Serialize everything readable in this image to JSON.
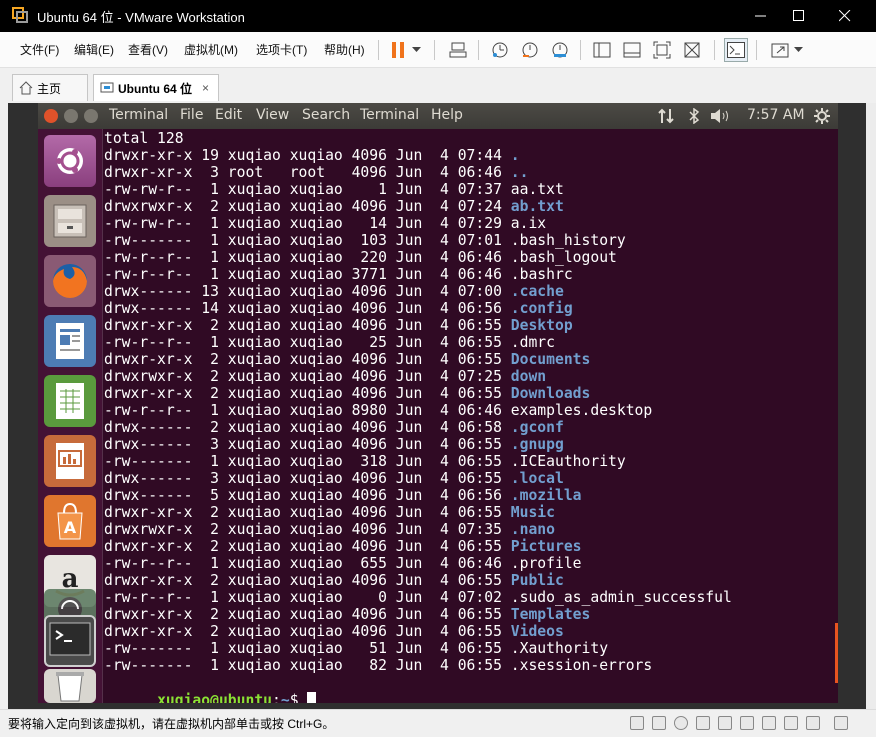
{
  "window": {
    "title": "Ubuntu 64 位 - VMware Workstation",
    "minimize_glyph": "—",
    "maximize_glyph": "☐",
    "close_glyph": "✕"
  },
  "menu": [
    "文件(F)",
    "编辑(E)",
    "查看(V)",
    "虚拟机(M)",
    "选项卡(T)",
    "帮助(H)"
  ],
  "toolbar": {
    "icons": [
      "pause-icon",
      "dropdown-icon",
      "send-ctrl-alt-del-icon",
      "snapshot-icon",
      "revert-snapshot-icon",
      "snapshot-manager-icon",
      "console-view-icon",
      "quick-switch-icon",
      "fullscreen-icon",
      "unity-icon",
      "terminal-console-icon",
      "stretch-icon",
      "dropdown-icon"
    ]
  },
  "tabs": [
    {
      "label": "主页",
      "icon": "home-icon"
    },
    {
      "label": "Ubuntu 64 位",
      "icon": "vm-icon",
      "close": "×"
    }
  ],
  "ubuntu": {
    "menus": [
      "Terminal",
      "File",
      "Edit",
      "View",
      "Search",
      "Terminal",
      "Help"
    ],
    "clock": "7:57 AM",
    "tray_icons": [
      "network-icon",
      "bluetooth-icon",
      "volume-icon",
      "settings-icon"
    ],
    "launcher": [
      "ubuntu-dash-icon",
      "files-icon",
      "firefox-icon",
      "writer-icon",
      "calc-icon",
      "impress-icon",
      "software-center-icon",
      "amazon-icon",
      "updater-icon",
      "terminal-icon",
      "trash-icon"
    ]
  },
  "terminal": {
    "total": "total 128",
    "entries": [
      {
        "meta": "drwxr-xr-x 19 xuqiao xuqiao 4096 Jun  4 07:44 ",
        "name": ".",
        "dir": true
      },
      {
        "meta": "drwxr-xr-x  3 root   root   4096 Jun  4 06:46 ",
        "name": "..",
        "dir": true
      },
      {
        "meta": "-rw-rw-r--  1 xuqiao xuqiao    1 Jun  4 07:37 ",
        "name": "aa.txt",
        "dir": false
      },
      {
        "meta": "drwxrwxr-x  2 xuqiao xuqiao 4096 Jun  4 07:24 ",
        "name": "ab.txt",
        "dir": true
      },
      {
        "meta": "-rw-rw-r--  1 xuqiao xuqiao   14 Jun  4 07:29 ",
        "name": "a.ix",
        "dir": false
      },
      {
        "meta": "-rw-------  1 xuqiao xuqiao  103 Jun  4 07:01 ",
        "name": ".bash_history",
        "dir": false
      },
      {
        "meta": "-rw-r--r--  1 xuqiao xuqiao  220 Jun  4 06:46 ",
        "name": ".bash_logout",
        "dir": false
      },
      {
        "meta": "-rw-r--r--  1 xuqiao xuqiao 3771 Jun  4 06:46 ",
        "name": ".bashrc",
        "dir": false
      },
      {
        "meta": "drwx------ 13 xuqiao xuqiao 4096 Jun  4 07:00 ",
        "name": ".cache",
        "dir": true
      },
      {
        "meta": "drwx------ 14 xuqiao xuqiao 4096 Jun  4 06:56 ",
        "name": ".config",
        "dir": true
      },
      {
        "meta": "drwxr-xr-x  2 xuqiao xuqiao 4096 Jun  4 06:55 ",
        "name": "Desktop",
        "dir": true
      },
      {
        "meta": "-rw-r--r--  1 xuqiao xuqiao   25 Jun  4 06:55 ",
        "name": ".dmrc",
        "dir": false
      },
      {
        "meta": "drwxr-xr-x  2 xuqiao xuqiao 4096 Jun  4 06:55 ",
        "name": "Documents",
        "dir": true
      },
      {
        "meta": "drwxrwxr-x  2 xuqiao xuqiao 4096 Jun  4 07:25 ",
        "name": "down",
        "dir": true
      },
      {
        "meta": "drwxr-xr-x  2 xuqiao xuqiao 4096 Jun  4 06:55 ",
        "name": "Downloads",
        "dir": true
      },
      {
        "meta": "-rw-r--r--  1 xuqiao xuqiao 8980 Jun  4 06:46 ",
        "name": "examples.desktop",
        "dir": false
      },
      {
        "meta": "drwx------  2 xuqiao xuqiao 4096 Jun  4 06:58 ",
        "name": ".gconf",
        "dir": true
      },
      {
        "meta": "drwx------  3 xuqiao xuqiao 4096 Jun  4 06:55 ",
        "name": ".gnupg",
        "dir": true
      },
      {
        "meta": "-rw-------  1 xuqiao xuqiao  318 Jun  4 06:55 ",
        "name": ".ICEauthority",
        "dir": false
      },
      {
        "meta": "drwx------  3 xuqiao xuqiao 4096 Jun  4 06:55 ",
        "name": ".local",
        "dir": true
      },
      {
        "meta": "drwx------  5 xuqiao xuqiao 4096 Jun  4 06:56 ",
        "name": ".mozilla",
        "dir": true
      },
      {
        "meta": "drwxr-xr-x  2 xuqiao xuqiao 4096 Jun  4 06:55 ",
        "name": "Music",
        "dir": true
      },
      {
        "meta": "drwxrwxr-x  2 xuqiao xuqiao 4096 Jun  4 07:35 ",
        "name": ".nano",
        "dir": true
      },
      {
        "meta": "drwxr-xr-x  2 xuqiao xuqiao 4096 Jun  4 06:55 ",
        "name": "Pictures",
        "dir": true
      },
      {
        "meta": "-rw-r--r--  1 xuqiao xuqiao  655 Jun  4 06:46 ",
        "name": ".profile",
        "dir": false
      },
      {
        "meta": "drwxr-xr-x  2 xuqiao xuqiao 4096 Jun  4 06:55 ",
        "name": "Public",
        "dir": true
      },
      {
        "meta": "-rw-r--r--  1 xuqiao xuqiao    0 Jun  4 07:02 ",
        "name": ".sudo_as_admin_successful",
        "dir": false
      },
      {
        "meta": "drwxr-xr-x  2 xuqiao xuqiao 4096 Jun  4 06:55 ",
        "name": "Templates",
        "dir": true
      },
      {
        "meta": "drwxr-xr-x  2 xuqiao xuqiao 4096 Jun  4 06:55 ",
        "name": "Videos",
        "dir": true
      },
      {
        "meta": "-rw-------  1 xuqiao xuqiao   51 Jun  4 06:55 ",
        "name": ".Xauthority",
        "dir": false
      },
      {
        "meta": "-rw-------  1 xuqiao xuqiao   82 Jun  4 06:55 ",
        "name": ".xsession-errors",
        "dir": false
      }
    ],
    "prompt_user": "xuqiao@ubuntu",
    "prompt_sep": ":",
    "prompt_path": "~",
    "prompt_char": "$ "
  },
  "status": {
    "message": "要将输入定向到该虚拟机，请在虚拟机内部单击或按 Ctrl+G。"
  },
  "colors": {
    "terminal_bg": "#300a24",
    "dir": "#729fcf",
    "prompt_user": "#8ae234",
    "accent": "#e95420"
  }
}
